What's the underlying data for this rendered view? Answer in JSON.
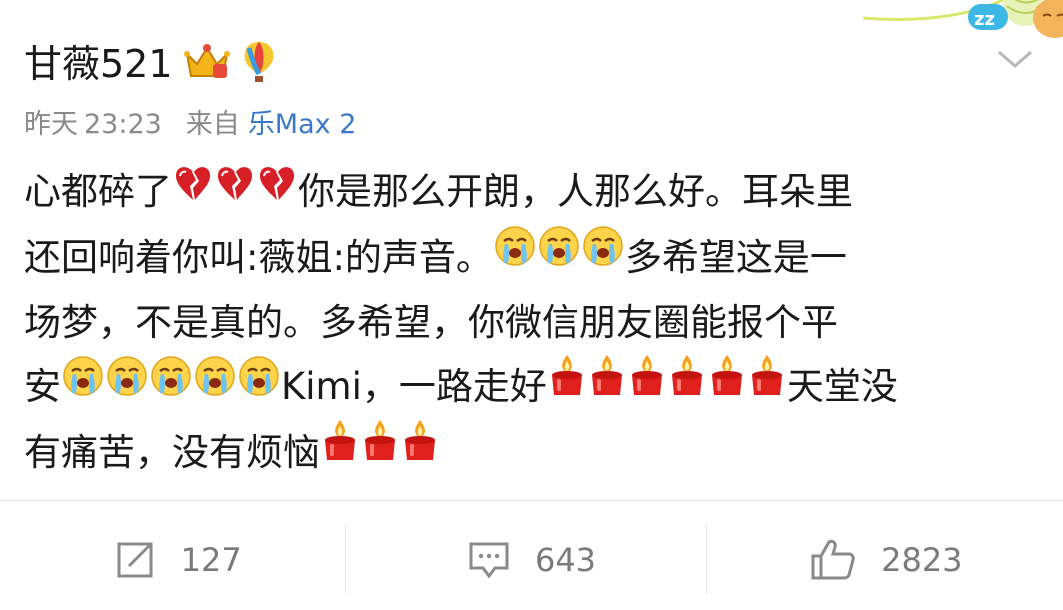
{
  "post": {
    "author": "甘薇521",
    "time_label": "昨天",
    "time": "23:23",
    "from_label": "来自",
    "device": "乐Max 2",
    "lines": [
      {
        "parts": [
          {
            "t": "text",
            "v": "心都碎了"
          },
          {
            "t": "emoji",
            "icon": "broken-heart-icon"
          },
          {
            "t": "emoji",
            "icon": "broken-heart-icon"
          },
          {
            "t": "emoji",
            "icon": "broken-heart-icon"
          },
          {
            "t": "text",
            "v": "你是那么开朗，人那么好。耳朵里"
          }
        ]
      },
      {
        "parts": [
          {
            "t": "text",
            "v": "还回响着你叫:薇姐:的声音。"
          },
          {
            "t": "emoji",
            "icon": "crying-face-icon"
          },
          {
            "t": "emoji",
            "icon": "crying-face-icon"
          },
          {
            "t": "emoji",
            "icon": "crying-face-icon"
          },
          {
            "t": "text",
            "v": "多希望这是一"
          }
        ]
      },
      {
        "parts": [
          {
            "t": "text",
            "v": "场梦，不是真的。多希望，你微信朋友圈能报个平"
          }
        ]
      },
      {
        "parts": [
          {
            "t": "text",
            "v": "安"
          },
          {
            "t": "emoji",
            "icon": "crying-face-icon"
          },
          {
            "t": "emoji",
            "icon": "crying-face-icon"
          },
          {
            "t": "emoji",
            "icon": "crying-face-icon"
          },
          {
            "t": "emoji",
            "icon": "crying-face-icon"
          },
          {
            "t": "emoji",
            "icon": "crying-face-icon"
          },
          {
            "t": "text",
            "v": "Kimi，一路走好"
          },
          {
            "t": "emoji",
            "icon": "candle-icon"
          },
          {
            "t": "emoji",
            "icon": "candle-icon"
          },
          {
            "t": "emoji",
            "icon": "candle-icon"
          },
          {
            "t": "emoji",
            "icon": "candle-icon"
          },
          {
            "t": "emoji",
            "icon": "candle-icon"
          },
          {
            "t": "emoji",
            "icon": "candle-icon"
          },
          {
            "t": "text",
            "v": "天堂没"
          }
        ]
      },
      {
        "parts": [
          {
            "t": "text",
            "v": "有痛苦，没有烦恼"
          },
          {
            "t": "emoji",
            "icon": "candle-icon"
          },
          {
            "t": "emoji",
            "icon": "candle-icon"
          },
          {
            "t": "emoji",
            "icon": "candle-icon"
          }
        ]
      }
    ]
  },
  "actions": {
    "repost_count": "127",
    "comment_count": "643",
    "like_count": "2823"
  },
  "colors": {
    "link": "#3a79c8",
    "meta": "#8a8a8a",
    "action": "#7a7a7a"
  }
}
